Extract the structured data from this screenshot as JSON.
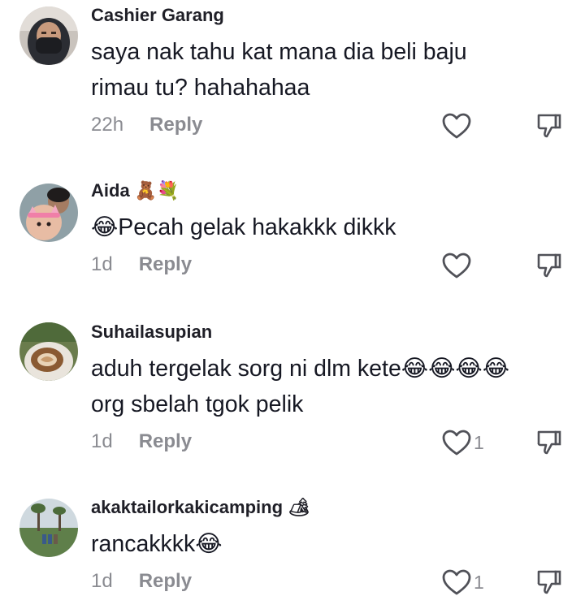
{
  "comments": [
    {
      "username": "Cashier Garang",
      "badge": "",
      "text": "saya nak tahu kat mana dia beli baju\nrimau tu? hahahahaa",
      "time": "22h",
      "reply_label": "Reply",
      "like_count": ""
    },
    {
      "username": "Aida",
      "badge": "🧸💐",
      "text": "😂Pecah gelak hakakkk dikkk",
      "time": "1d",
      "reply_label": "Reply",
      "like_count": ""
    },
    {
      "username": "Suhailasupian",
      "badge": "",
      "text": "aduh tergelak sorg ni dlm kete😂😂😂😂\norg sbelah tgok pelik",
      "time": "1d",
      "reply_label": "Reply",
      "like_count": "1"
    },
    {
      "username": "akaktailorkakicamping",
      "badge": "🏕",
      "text": "rancakkkk😂",
      "time": "1d",
      "reply_label": "Reply",
      "like_count": "1"
    }
  ],
  "icons": {
    "like": "heart-outline-icon",
    "dislike": "thumbs-down-icon"
  },
  "colors": {
    "text": "#161823",
    "secondary": "#8a8b91",
    "username": "#1f1f27"
  }
}
